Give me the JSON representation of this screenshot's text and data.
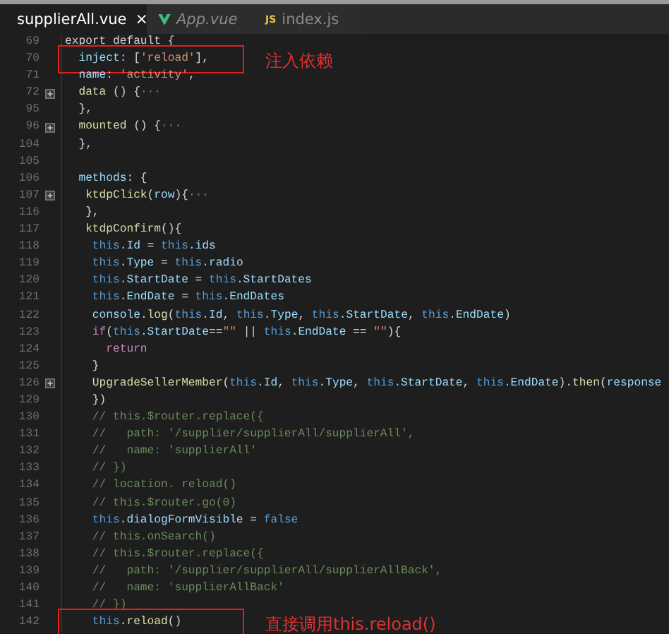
{
  "tabs": [
    {
      "label": "supplierAll.vue",
      "selected": true,
      "kind": "vue",
      "italic": false,
      "close": "×"
    },
    {
      "label": "App.vue",
      "selected": false,
      "kind": "vue",
      "italic": true
    },
    {
      "label": "index.js",
      "selected": false,
      "kind": "js",
      "badge": "JS",
      "italic": false
    }
  ],
  "lines": [
    {
      "number": "69",
      "fold": false,
      "segments": [
        {
          "kind": "plain",
          "text": "export default {"
        }
      ]
    },
    {
      "number": "70",
      "fold": false,
      "segments": [
        {
          "kind": "prop",
          "text": "  inject"
        },
        {
          "kind": "plain",
          "text": ": ["
        },
        {
          "kind": "string",
          "text": "'reload'"
        },
        {
          "kind": "plain",
          "text": "],"
        }
      ],
      "annotation": "注入依赖"
    },
    {
      "number": "71",
      "fold": false,
      "segments": [
        {
          "kind": "prop",
          "text": "  name"
        },
        {
          "kind": "plain",
          "text": ": "
        },
        {
          "kind": "string",
          "text": "'activity'"
        },
        {
          "kind": "plain",
          "text": ","
        }
      ]
    },
    {
      "number": "72",
      "fold": true,
      "segments": [
        {
          "kind": "func",
          "text": "  data"
        },
        {
          "kind": "plain",
          "text": " () {"
        },
        {
          "kind": "folded",
          "text": "···"
        }
      ]
    },
    {
      "number": "95",
      "fold": false,
      "segments": [
        {
          "kind": "plain",
          "text": "  },"
        }
      ]
    },
    {
      "number": "96",
      "fold": true,
      "segments": [
        {
          "kind": "func",
          "text": "  mounted"
        },
        {
          "kind": "plain",
          "text": " () {"
        },
        {
          "kind": "folded",
          "text": "···"
        }
      ]
    },
    {
      "number": "104",
      "fold": false,
      "segments": [
        {
          "kind": "plain",
          "text": "  },"
        }
      ]
    },
    {
      "number": "105",
      "fold": false
    },
    {
      "number": "106",
      "fold": false,
      "segments": [
        {
          "kind": "prop",
          "text": "  methods"
        },
        {
          "kind": "plain",
          "text": ": {"
        }
      ]
    },
    {
      "number": "107",
      "fold": true,
      "segments": [
        {
          "kind": "func",
          "text": "   ktdpClick"
        },
        {
          "kind": "plain",
          "text": "("
        },
        {
          "kind": "prop",
          "text": "row"
        },
        {
          "kind": "plain",
          "text": "){"
        },
        {
          "kind": "folded",
          "text": "···"
        }
      ]
    },
    {
      "number": "116",
      "fold": false,
      "segments": [
        {
          "kind": "plain",
          "text": "   },"
        }
      ]
    },
    {
      "number": "117",
      "fold": false,
      "segments": [
        {
          "kind": "func",
          "text": "   ktdpConfirm"
        },
        {
          "kind": "plain",
          "text": "(){"
        }
      ]
    },
    {
      "number": "118",
      "fold": false,
      "segments": [
        {
          "kind": "this",
          "text": "    this"
        },
        {
          "kind": "prop",
          "text": ".Id"
        },
        {
          "kind": "plain",
          "text": " = "
        },
        {
          "kind": "this",
          "text": "this"
        },
        {
          "kind": "prop",
          "text": ".ids"
        }
      ]
    },
    {
      "number": "119",
      "fold": false,
      "segments": [
        {
          "kind": "this",
          "text": "    this"
        },
        {
          "kind": "prop",
          "text": ".Type"
        },
        {
          "kind": "plain",
          "text": " = "
        },
        {
          "kind": "this",
          "text": "this"
        },
        {
          "kind": "prop",
          "text": ".radio"
        }
      ]
    },
    {
      "number": "120",
      "fold": false,
      "segments": [
        {
          "kind": "this",
          "text": "    this"
        },
        {
          "kind": "prop",
          "text": ".StartDate"
        },
        {
          "kind": "plain",
          "text": " = "
        },
        {
          "kind": "this",
          "text": "this"
        },
        {
          "kind": "prop",
          "text": ".StartDates"
        }
      ]
    },
    {
      "number": "121",
      "fold": false,
      "segments": [
        {
          "kind": "this",
          "text": "    this"
        },
        {
          "kind": "prop",
          "text": ".EndDate"
        },
        {
          "kind": "plain",
          "text": " = "
        },
        {
          "kind": "this",
          "text": "this"
        },
        {
          "kind": "prop",
          "text": ".EndDates"
        }
      ]
    },
    {
      "number": "122",
      "fold": false,
      "segments": [
        {
          "kind": "prop",
          "text": "    console"
        },
        {
          "kind": "plain",
          "text": "."
        },
        {
          "kind": "func",
          "text": "log"
        },
        {
          "kind": "plain",
          "text": "("
        },
        {
          "kind": "this",
          "text": "this"
        },
        {
          "kind": "prop",
          "text": ".Id"
        },
        {
          "kind": "plain",
          "text": ", "
        },
        {
          "kind": "this",
          "text": "this"
        },
        {
          "kind": "prop",
          "text": ".Type"
        },
        {
          "kind": "plain",
          "text": ", "
        },
        {
          "kind": "this",
          "text": "this"
        },
        {
          "kind": "prop",
          "text": ".StartDate"
        },
        {
          "kind": "plain",
          "text": ", "
        },
        {
          "kind": "this",
          "text": "this"
        },
        {
          "kind": "prop",
          "text": ".EndDate"
        },
        {
          "kind": "plain",
          "text": ")"
        }
      ]
    },
    {
      "number": "123",
      "fold": false,
      "segments": [
        {
          "kind": "keyword",
          "text": "    if"
        },
        {
          "kind": "plain",
          "text": "("
        },
        {
          "kind": "this",
          "text": "this"
        },
        {
          "kind": "prop",
          "text": ".StartDate"
        },
        {
          "kind": "plain",
          "text": "=="
        },
        {
          "kind": "string",
          "text": "\"\""
        },
        {
          "kind": "plain",
          "text": " || "
        },
        {
          "kind": "this",
          "text": "this"
        },
        {
          "kind": "prop",
          "text": ".EndDate"
        },
        {
          "kind": "plain",
          "text": " == "
        },
        {
          "kind": "string",
          "text": "\"\""
        },
        {
          "kind": "plain",
          "text": "){"
        }
      ]
    },
    {
      "number": "124",
      "fold": false,
      "segments": [
        {
          "kind": "keyword",
          "text": "      return"
        }
      ]
    },
    {
      "number": "125",
      "fold": false,
      "segments": [
        {
          "kind": "plain",
          "text": "    }"
        }
      ]
    },
    {
      "number": "126",
      "fold": true,
      "segments": [
        {
          "kind": "func",
          "text": "    UpgradeSellerMember"
        },
        {
          "kind": "plain",
          "text": "("
        },
        {
          "kind": "this",
          "text": "this"
        },
        {
          "kind": "prop",
          "text": ".Id"
        },
        {
          "kind": "plain",
          "text": ", "
        },
        {
          "kind": "this",
          "text": "this"
        },
        {
          "kind": "prop",
          "text": ".Type"
        },
        {
          "kind": "plain",
          "text": ", "
        },
        {
          "kind": "this",
          "text": "this"
        },
        {
          "kind": "prop",
          "text": ".StartDate"
        },
        {
          "kind": "plain",
          "text": ", "
        },
        {
          "kind": "this",
          "text": "this"
        },
        {
          "kind": "prop",
          "text": ".EndDate"
        },
        {
          "kind": "plain",
          "text": ")."
        },
        {
          "kind": "func",
          "text": "then"
        },
        {
          "kind": "plain",
          "text": "("
        },
        {
          "kind": "prop",
          "text": "response"
        }
      ]
    },
    {
      "number": "129",
      "fold": false,
      "segments": [
        {
          "kind": "plain",
          "text": "    })"
        }
      ]
    },
    {
      "number": "130",
      "fold": false,
      "segments": [
        {
          "kind": "comment",
          "text": "    // this.$router.replace({"
        }
      ]
    },
    {
      "number": "131",
      "fold": false,
      "segments": [
        {
          "kind": "comment",
          "text": "    //   path: '/supplier/supplierAll/supplierAll',"
        }
      ]
    },
    {
      "number": "132",
      "fold": false,
      "segments": [
        {
          "kind": "comment",
          "text": "    //   name: 'supplierAll'"
        }
      ]
    },
    {
      "number": "133",
      "fold": false,
      "segments": [
        {
          "kind": "comment",
          "text": "    // })"
        }
      ]
    },
    {
      "number": "134",
      "fold": false,
      "segments": [
        {
          "kind": "comment",
          "text": "    // location. reload()"
        }
      ]
    },
    {
      "number": "135",
      "fold": false,
      "segments": [
        {
          "kind": "comment",
          "text": "    // this.$router.go(0)"
        }
      ]
    },
    {
      "number": "136",
      "fold": false,
      "segments": [
        {
          "kind": "this",
          "text": "    this"
        },
        {
          "kind": "prop",
          "text": ".dialogFormVisible"
        },
        {
          "kind": "plain",
          "text": " = "
        },
        {
          "kind": "this",
          "text": "false"
        }
      ]
    },
    {
      "number": "137",
      "fold": false,
      "segments": [
        {
          "kind": "comment",
          "text": "    // this.onSearch()"
        }
      ]
    },
    {
      "number": "138",
      "fold": false,
      "segments": [
        {
          "kind": "comment",
          "text": "    // this.$router.replace({"
        }
      ]
    },
    {
      "number": "139",
      "fold": false,
      "segments": [
        {
          "kind": "comment",
          "text": "    //   path: '/supplier/supplierAll/supplierAllBack',"
        }
      ]
    },
    {
      "number": "140",
      "fold": false,
      "segments": [
        {
          "kind": "comment",
          "text": "    //   name: 'supplierAllBack'"
        }
      ]
    },
    {
      "number": "141",
      "fold": false,
      "segments": [
        {
          "kind": "comment",
          "text": "    // })"
        }
      ]
    },
    {
      "number": "142",
      "fold": false,
      "segments": [
        {
          "kind": "this",
          "text": "    this"
        },
        {
          "kind": "plain",
          "text": "."
        },
        {
          "kind": "func",
          "text": "reload"
        },
        {
          "kind": "plain",
          "text": "()"
        }
      ],
      "annotation": "直接调用this.reload()"
    }
  ]
}
